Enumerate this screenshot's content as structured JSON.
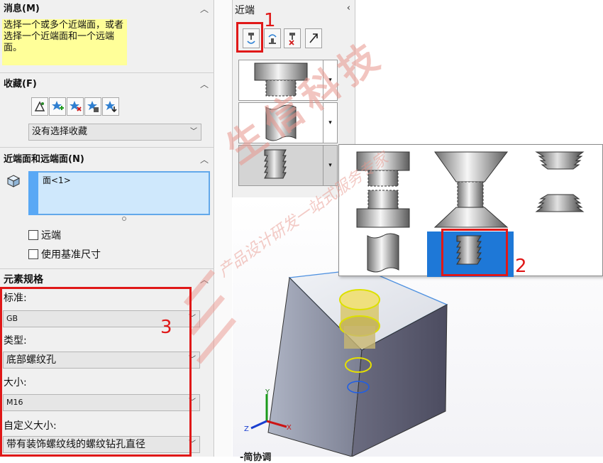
{
  "left_panel": {
    "message": {
      "title": "消息(M)",
      "text": "选择一个或多个近端面，或者选择一个近端面和一个远端面。"
    },
    "favorites": {
      "title": "收藏(F)",
      "selected": "没有选择收藏"
    },
    "faces": {
      "title": "近端面和远端面(N)",
      "item": "面<1>",
      "far_end": "远端",
      "use_base_size": "使用基准尺寸"
    },
    "spec": {
      "title": "元素规格",
      "standard_label": "标准:",
      "standard_value": "GB",
      "type_label": "类型:",
      "type_value": "底部螺纹孔",
      "size_label": "大小:",
      "size_value": "M16",
      "custom_size_label": "自定义大小:",
      "custom_size_value": "带有装饰螺纹线的螺纹钻孔直径"
    }
  },
  "middle_panel": {
    "title": "近端"
  },
  "annotations": [
    "1",
    "2",
    "3"
  ],
  "viewport": {
    "footer_text": "-简协调"
  },
  "watermark": {
    "main": "生信科技",
    "sub": "产品设计研发一站式服务专家"
  },
  "axes": {
    "x": "X",
    "y": "Y",
    "z": "Z"
  },
  "colors": {
    "highlight": "#ffff99",
    "selection": "#cfe8fc",
    "accent_blue": "#1e78d7",
    "annotation_red": "#e01818",
    "cube_face": "#6f7082"
  }
}
